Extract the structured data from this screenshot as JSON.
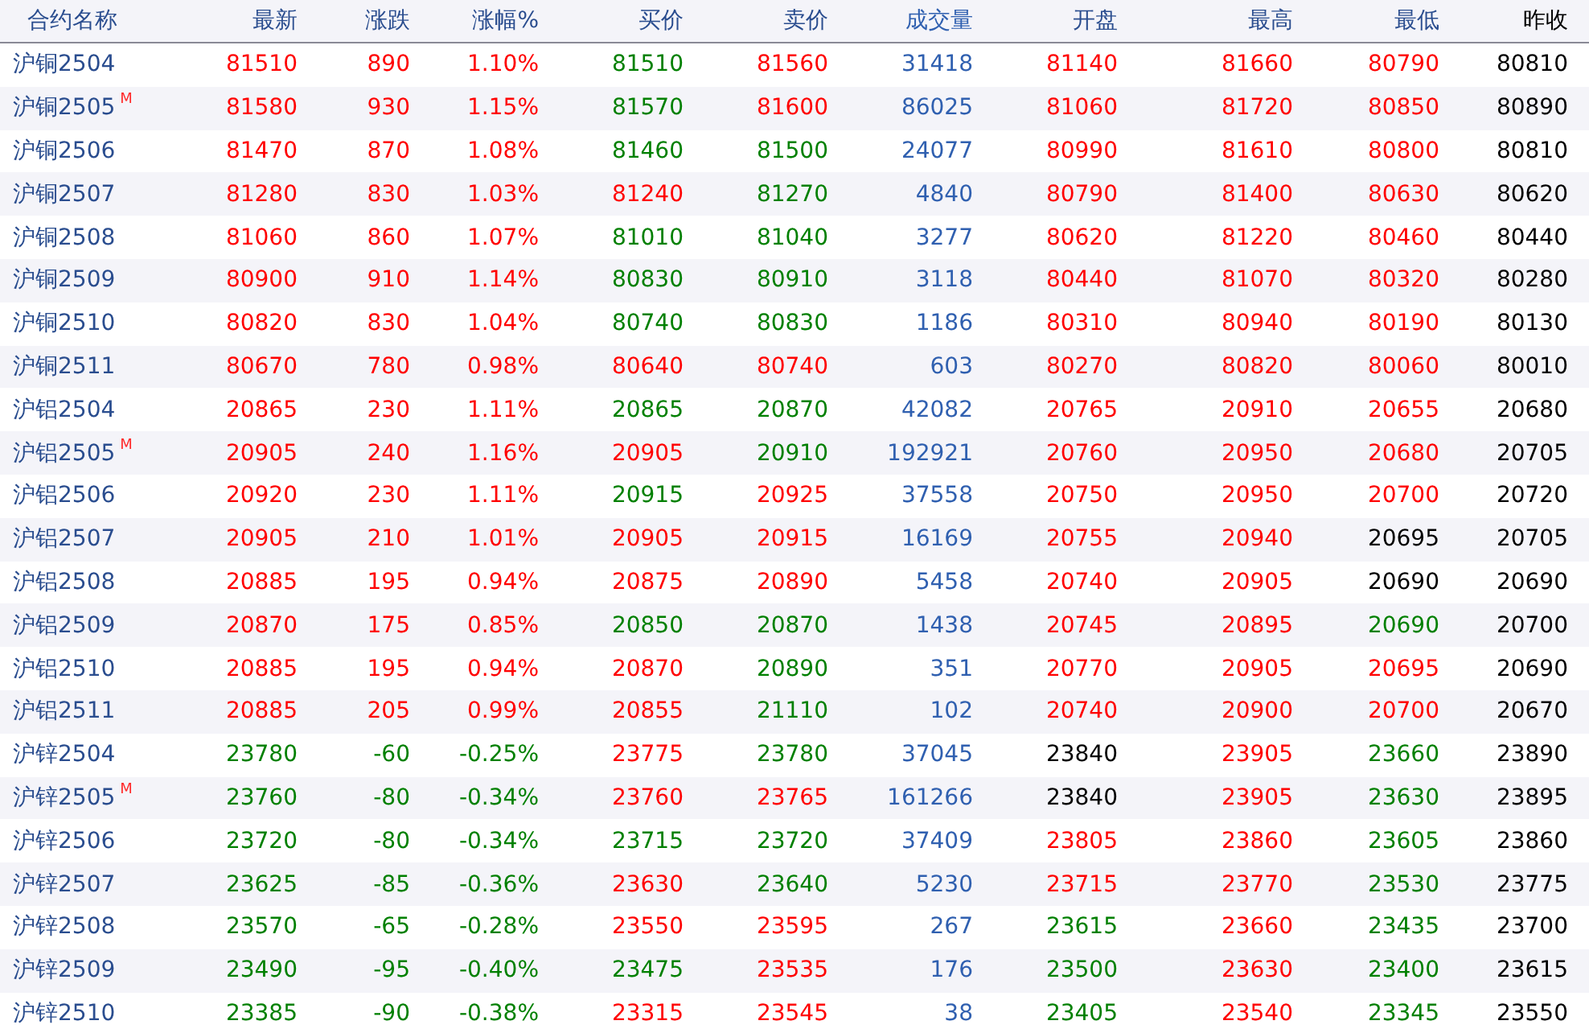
{
  "table": {
    "columns": [
      {
        "label": "合约名称",
        "kind": "name"
      },
      {
        "label": "最新",
        "kind": "price"
      },
      {
        "label": "涨跌",
        "kind": "price"
      },
      {
        "label": "涨幅%",
        "kind": "price"
      },
      {
        "label": "买价",
        "kind": "price"
      },
      {
        "label": "卖价",
        "kind": "price"
      },
      {
        "label": "成交量",
        "kind": "volume"
      },
      {
        "label": "开盘",
        "kind": "price"
      },
      {
        "label": "最高",
        "kind": "price"
      },
      {
        "label": "最低",
        "kind": "price"
      },
      {
        "label": "昨收",
        "kind": "close"
      }
    ],
    "rows": [
      {
        "cells": [
          {
            "value": "沪铜2504"
          },
          {
            "value": "81510",
            "color": "#ff0000"
          },
          {
            "value": "890",
            "color": "#ff0000"
          },
          {
            "value": "1.10%",
            "color": "#ff0000"
          },
          {
            "value": "81510",
            "color": "#008000"
          },
          {
            "value": "81560",
            "color": "#ff0000"
          },
          {
            "value": "31418"
          },
          {
            "value": "81140",
            "color": "#ff0000"
          },
          {
            "value": "81660",
            "color": "#ff0000"
          },
          {
            "value": "80790",
            "color": "#ff0000"
          },
          {
            "value": "80810"
          }
        ]
      },
      {
        "cells": [
          {
            "value": "沪铜2505",
            "badge": "M"
          },
          {
            "value": "81580",
            "color": "#ff0000"
          },
          {
            "value": "930",
            "color": "#ff0000"
          },
          {
            "value": "1.15%",
            "color": "#ff0000"
          },
          {
            "value": "81570",
            "color": "#008000"
          },
          {
            "value": "81600",
            "color": "#ff0000"
          },
          {
            "value": "86025"
          },
          {
            "value": "81060",
            "color": "#ff0000"
          },
          {
            "value": "81720",
            "color": "#ff0000"
          },
          {
            "value": "80850",
            "color": "#ff0000"
          },
          {
            "value": "80890"
          }
        ]
      },
      {
        "cells": [
          {
            "value": "沪铜2506"
          },
          {
            "value": "81470",
            "color": "#ff0000"
          },
          {
            "value": "870",
            "color": "#ff0000"
          },
          {
            "value": "1.08%",
            "color": "#ff0000"
          },
          {
            "value": "81460",
            "color": "#008000"
          },
          {
            "value": "81500",
            "color": "#008000"
          },
          {
            "value": "24077"
          },
          {
            "value": "80990",
            "color": "#ff0000"
          },
          {
            "value": "81610",
            "color": "#ff0000"
          },
          {
            "value": "80800",
            "color": "#ff0000"
          },
          {
            "value": "80810"
          }
        ]
      },
      {
        "cells": [
          {
            "value": "沪铜2507"
          },
          {
            "value": "81280",
            "color": "#ff0000"
          },
          {
            "value": "830",
            "color": "#ff0000"
          },
          {
            "value": "1.03%",
            "color": "#ff0000"
          },
          {
            "value": "81240",
            "color": "#ff0000"
          },
          {
            "value": "81270",
            "color": "#008000"
          },
          {
            "value": "4840"
          },
          {
            "value": "80790",
            "color": "#ff0000"
          },
          {
            "value": "81400",
            "color": "#ff0000"
          },
          {
            "value": "80630",
            "color": "#ff0000"
          },
          {
            "value": "80620"
          }
        ]
      },
      {
        "cells": [
          {
            "value": "沪铜2508"
          },
          {
            "value": "81060",
            "color": "#ff0000"
          },
          {
            "value": "860",
            "color": "#ff0000"
          },
          {
            "value": "1.07%",
            "color": "#ff0000"
          },
          {
            "value": "81010",
            "color": "#008000"
          },
          {
            "value": "81040",
            "color": "#008000"
          },
          {
            "value": "3277"
          },
          {
            "value": "80620",
            "color": "#ff0000"
          },
          {
            "value": "81220",
            "color": "#ff0000"
          },
          {
            "value": "80460",
            "color": "#ff0000"
          },
          {
            "value": "80440"
          }
        ]
      },
      {
        "cells": [
          {
            "value": "沪铜2509"
          },
          {
            "value": "80900",
            "color": "#ff0000"
          },
          {
            "value": "910",
            "color": "#ff0000"
          },
          {
            "value": "1.14%",
            "color": "#ff0000"
          },
          {
            "value": "80830",
            "color": "#008000"
          },
          {
            "value": "80910",
            "color": "#008000"
          },
          {
            "value": "3118"
          },
          {
            "value": "80440",
            "color": "#ff0000"
          },
          {
            "value": "81070",
            "color": "#ff0000"
          },
          {
            "value": "80320",
            "color": "#ff0000"
          },
          {
            "value": "80280"
          }
        ]
      },
      {
        "cells": [
          {
            "value": "沪铜2510"
          },
          {
            "value": "80820",
            "color": "#ff0000"
          },
          {
            "value": "830",
            "color": "#ff0000"
          },
          {
            "value": "1.04%",
            "color": "#ff0000"
          },
          {
            "value": "80740",
            "color": "#008000"
          },
          {
            "value": "80830",
            "color": "#008000"
          },
          {
            "value": "1186"
          },
          {
            "value": "80310",
            "color": "#ff0000"
          },
          {
            "value": "80940",
            "color": "#ff0000"
          },
          {
            "value": "80190",
            "color": "#ff0000"
          },
          {
            "value": "80130"
          }
        ]
      },
      {
        "cells": [
          {
            "value": "沪铜2511"
          },
          {
            "value": "80670",
            "color": "#ff0000"
          },
          {
            "value": "780",
            "color": "#ff0000"
          },
          {
            "value": "0.98%",
            "color": "#ff0000"
          },
          {
            "value": "80640",
            "color": "#ff0000"
          },
          {
            "value": "80740",
            "color": "#ff0000"
          },
          {
            "value": "603"
          },
          {
            "value": "80270",
            "color": "#ff0000"
          },
          {
            "value": "80820",
            "color": "#ff0000"
          },
          {
            "value": "80060",
            "color": "#ff0000"
          },
          {
            "value": "80010"
          }
        ]
      },
      {
        "cells": [
          {
            "value": "沪铝2504"
          },
          {
            "value": "20865",
            "color": "#ff0000"
          },
          {
            "value": "230",
            "color": "#ff0000"
          },
          {
            "value": "1.11%",
            "color": "#ff0000"
          },
          {
            "value": "20865",
            "color": "#008000"
          },
          {
            "value": "20870",
            "color": "#008000"
          },
          {
            "value": "42082"
          },
          {
            "value": "20765",
            "color": "#ff0000"
          },
          {
            "value": "20910",
            "color": "#ff0000"
          },
          {
            "value": "20655",
            "color": "#ff0000"
          },
          {
            "value": "20680"
          }
        ]
      },
      {
        "cells": [
          {
            "value": "沪铝2505",
            "badge": "M"
          },
          {
            "value": "20905",
            "color": "#ff0000"
          },
          {
            "value": "240",
            "color": "#ff0000"
          },
          {
            "value": "1.16%",
            "color": "#ff0000"
          },
          {
            "value": "20905",
            "color": "#ff0000"
          },
          {
            "value": "20910",
            "color": "#008000"
          },
          {
            "value": "192921"
          },
          {
            "value": "20760",
            "color": "#ff0000"
          },
          {
            "value": "20950",
            "color": "#ff0000"
          },
          {
            "value": "20680",
            "color": "#ff0000"
          },
          {
            "value": "20705"
          }
        ]
      },
      {
        "cells": [
          {
            "value": "沪铝2506"
          },
          {
            "value": "20920",
            "color": "#ff0000"
          },
          {
            "value": "230",
            "color": "#ff0000"
          },
          {
            "value": "1.11%",
            "color": "#ff0000"
          },
          {
            "value": "20915",
            "color": "#008000"
          },
          {
            "value": "20925",
            "color": "#ff0000"
          },
          {
            "value": "37558"
          },
          {
            "value": "20750",
            "color": "#ff0000"
          },
          {
            "value": "20950",
            "color": "#ff0000"
          },
          {
            "value": "20700",
            "color": "#ff0000"
          },
          {
            "value": "20720"
          }
        ]
      },
      {
        "cells": [
          {
            "value": "沪铝2507"
          },
          {
            "value": "20905",
            "color": "#ff0000"
          },
          {
            "value": "210",
            "color": "#ff0000"
          },
          {
            "value": "1.01%",
            "color": "#ff0000"
          },
          {
            "value": "20905",
            "color": "#ff0000"
          },
          {
            "value": "20915",
            "color": "#ff0000"
          },
          {
            "value": "16169"
          },
          {
            "value": "20755",
            "color": "#ff0000"
          },
          {
            "value": "20940",
            "color": "#ff0000"
          },
          {
            "value": "20695",
            "color": "#000000"
          },
          {
            "value": "20705"
          }
        ]
      },
      {
        "cells": [
          {
            "value": "沪铝2508"
          },
          {
            "value": "20885",
            "color": "#ff0000"
          },
          {
            "value": "195",
            "color": "#ff0000"
          },
          {
            "value": "0.94%",
            "color": "#ff0000"
          },
          {
            "value": "20875",
            "color": "#ff0000"
          },
          {
            "value": "20890",
            "color": "#ff0000"
          },
          {
            "value": "5458"
          },
          {
            "value": "20740",
            "color": "#ff0000"
          },
          {
            "value": "20905",
            "color": "#ff0000"
          },
          {
            "value": "20690",
            "color": "#000000"
          },
          {
            "value": "20690"
          }
        ]
      },
      {
        "cells": [
          {
            "value": "沪铝2509"
          },
          {
            "value": "20870",
            "color": "#ff0000"
          },
          {
            "value": "175",
            "color": "#ff0000"
          },
          {
            "value": "0.85%",
            "color": "#ff0000"
          },
          {
            "value": "20850",
            "color": "#008000"
          },
          {
            "value": "20870",
            "color": "#008000"
          },
          {
            "value": "1438"
          },
          {
            "value": "20745",
            "color": "#ff0000"
          },
          {
            "value": "20895",
            "color": "#ff0000"
          },
          {
            "value": "20690",
            "color": "#008000"
          },
          {
            "value": "20700"
          }
        ]
      },
      {
        "cells": [
          {
            "value": "沪铝2510"
          },
          {
            "value": "20885",
            "color": "#ff0000"
          },
          {
            "value": "195",
            "color": "#ff0000"
          },
          {
            "value": "0.94%",
            "color": "#ff0000"
          },
          {
            "value": "20870",
            "color": "#ff0000"
          },
          {
            "value": "20890",
            "color": "#008000"
          },
          {
            "value": "351"
          },
          {
            "value": "20770",
            "color": "#ff0000"
          },
          {
            "value": "20905",
            "color": "#ff0000"
          },
          {
            "value": "20695",
            "color": "#ff0000"
          },
          {
            "value": "20690"
          }
        ]
      },
      {
        "cells": [
          {
            "value": "沪铝2511"
          },
          {
            "value": "20885",
            "color": "#ff0000"
          },
          {
            "value": "205",
            "color": "#ff0000"
          },
          {
            "value": "0.99%",
            "color": "#ff0000"
          },
          {
            "value": "20855",
            "color": "#ff0000"
          },
          {
            "value": "21110",
            "color": "#008000"
          },
          {
            "value": "102"
          },
          {
            "value": "20740",
            "color": "#ff0000"
          },
          {
            "value": "20900",
            "color": "#ff0000"
          },
          {
            "value": "20700",
            "color": "#ff0000"
          },
          {
            "value": "20670"
          }
        ]
      },
      {
        "cells": [
          {
            "value": "沪锌2504"
          },
          {
            "value": "23780",
            "color": "#008000"
          },
          {
            "value": "-60",
            "color": "#008000"
          },
          {
            "value": "-0.25%",
            "color": "#008000"
          },
          {
            "value": "23775",
            "color": "#ff0000"
          },
          {
            "value": "23780",
            "color": "#008000"
          },
          {
            "value": "37045"
          },
          {
            "value": "23840",
            "color": "#000000"
          },
          {
            "value": "23905",
            "color": "#ff0000"
          },
          {
            "value": "23660",
            "color": "#008000"
          },
          {
            "value": "23890"
          }
        ]
      },
      {
        "cells": [
          {
            "value": "沪锌2505",
            "badge": "M"
          },
          {
            "value": "23760",
            "color": "#008000"
          },
          {
            "value": "-80",
            "color": "#008000"
          },
          {
            "value": "-0.34%",
            "color": "#008000"
          },
          {
            "value": "23760",
            "color": "#ff0000"
          },
          {
            "value": "23765",
            "color": "#ff0000"
          },
          {
            "value": "161266"
          },
          {
            "value": "23840",
            "color": "#000000"
          },
          {
            "value": "23905",
            "color": "#ff0000"
          },
          {
            "value": "23630",
            "color": "#008000"
          },
          {
            "value": "23895"
          }
        ]
      },
      {
        "cells": [
          {
            "value": "沪锌2506"
          },
          {
            "value": "23720",
            "color": "#008000"
          },
          {
            "value": "-80",
            "color": "#008000"
          },
          {
            "value": "-0.34%",
            "color": "#008000"
          },
          {
            "value": "23715",
            "color": "#008000"
          },
          {
            "value": "23720",
            "color": "#008000"
          },
          {
            "value": "37409"
          },
          {
            "value": "23805",
            "color": "#ff0000"
          },
          {
            "value": "23860",
            "color": "#ff0000"
          },
          {
            "value": "23605",
            "color": "#008000"
          },
          {
            "value": "23860"
          }
        ]
      },
      {
        "cells": [
          {
            "value": "沪锌2507"
          },
          {
            "value": "23625",
            "color": "#008000"
          },
          {
            "value": "-85",
            "color": "#008000"
          },
          {
            "value": "-0.36%",
            "color": "#008000"
          },
          {
            "value": "23630",
            "color": "#ff0000"
          },
          {
            "value": "23640",
            "color": "#008000"
          },
          {
            "value": "5230"
          },
          {
            "value": "23715",
            "color": "#ff0000"
          },
          {
            "value": "23770",
            "color": "#ff0000"
          },
          {
            "value": "23530",
            "color": "#008000"
          },
          {
            "value": "23775"
          }
        ]
      },
      {
        "cells": [
          {
            "value": "沪锌2508"
          },
          {
            "value": "23570",
            "color": "#008000"
          },
          {
            "value": "-65",
            "color": "#008000"
          },
          {
            "value": "-0.28%",
            "color": "#008000"
          },
          {
            "value": "23550",
            "color": "#ff0000"
          },
          {
            "value": "23595",
            "color": "#ff0000"
          },
          {
            "value": "267"
          },
          {
            "value": "23615",
            "color": "#008000"
          },
          {
            "value": "23660",
            "color": "#ff0000"
          },
          {
            "value": "23435",
            "color": "#008000"
          },
          {
            "value": "23700"
          }
        ]
      },
      {
        "cells": [
          {
            "value": "沪锌2509"
          },
          {
            "value": "23490",
            "color": "#008000"
          },
          {
            "value": "-95",
            "color": "#008000"
          },
          {
            "value": "-0.40%",
            "color": "#008000"
          },
          {
            "value": "23475",
            "color": "#008000"
          },
          {
            "value": "23535",
            "color": "#ff0000"
          },
          {
            "value": "176"
          },
          {
            "value": "23500",
            "color": "#008000"
          },
          {
            "value": "23630",
            "color": "#ff0000"
          },
          {
            "value": "23400",
            "color": "#008000"
          },
          {
            "value": "23615"
          }
        ]
      },
      {
        "cells": [
          {
            "value": "沪锌2510"
          },
          {
            "value": "23385",
            "color": "#008000"
          },
          {
            "value": "-90",
            "color": "#008000"
          },
          {
            "value": "-0.38%",
            "color": "#008000"
          },
          {
            "value": "23315",
            "color": "#ff0000"
          },
          {
            "value": "23545",
            "color": "#ff0000"
          },
          {
            "value": "38"
          },
          {
            "value": "23405",
            "color": "#008000"
          },
          {
            "value": "23540",
            "color": "#ff0000"
          },
          {
            "value": "23345",
            "color": "#008000"
          },
          {
            "value": "23550"
          }
        ]
      }
    ]
  }
}
